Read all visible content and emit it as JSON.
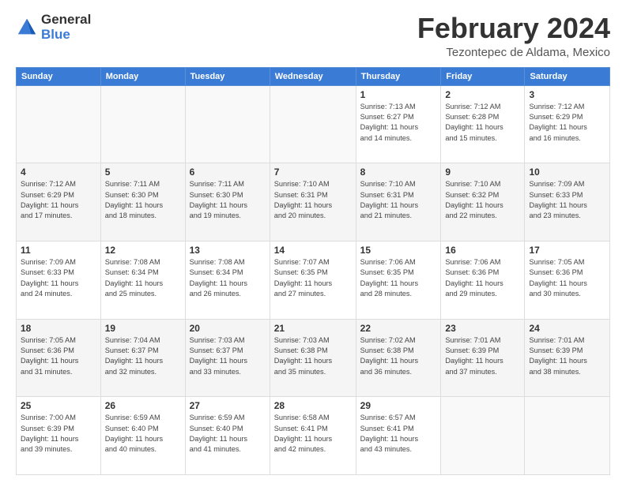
{
  "logo": {
    "general": "General",
    "blue": "Blue"
  },
  "title": "February 2024",
  "subtitle": "Tezontepec de Aldama, Mexico",
  "headers": [
    "Sunday",
    "Monday",
    "Tuesday",
    "Wednesday",
    "Thursday",
    "Friday",
    "Saturday"
  ],
  "weeks": [
    [
      {
        "day": "",
        "info": ""
      },
      {
        "day": "",
        "info": ""
      },
      {
        "day": "",
        "info": ""
      },
      {
        "day": "",
        "info": ""
      },
      {
        "day": "1",
        "info": "Sunrise: 7:13 AM\nSunset: 6:27 PM\nDaylight: 11 hours\nand 14 minutes."
      },
      {
        "day": "2",
        "info": "Sunrise: 7:12 AM\nSunset: 6:28 PM\nDaylight: 11 hours\nand 15 minutes."
      },
      {
        "day": "3",
        "info": "Sunrise: 7:12 AM\nSunset: 6:29 PM\nDaylight: 11 hours\nand 16 minutes."
      }
    ],
    [
      {
        "day": "4",
        "info": "Sunrise: 7:12 AM\nSunset: 6:29 PM\nDaylight: 11 hours\nand 17 minutes."
      },
      {
        "day": "5",
        "info": "Sunrise: 7:11 AM\nSunset: 6:30 PM\nDaylight: 11 hours\nand 18 minutes."
      },
      {
        "day": "6",
        "info": "Sunrise: 7:11 AM\nSunset: 6:30 PM\nDaylight: 11 hours\nand 19 minutes."
      },
      {
        "day": "7",
        "info": "Sunrise: 7:10 AM\nSunset: 6:31 PM\nDaylight: 11 hours\nand 20 minutes."
      },
      {
        "day": "8",
        "info": "Sunrise: 7:10 AM\nSunset: 6:31 PM\nDaylight: 11 hours\nand 21 minutes."
      },
      {
        "day": "9",
        "info": "Sunrise: 7:10 AM\nSunset: 6:32 PM\nDaylight: 11 hours\nand 22 minutes."
      },
      {
        "day": "10",
        "info": "Sunrise: 7:09 AM\nSunset: 6:33 PM\nDaylight: 11 hours\nand 23 minutes."
      }
    ],
    [
      {
        "day": "11",
        "info": "Sunrise: 7:09 AM\nSunset: 6:33 PM\nDaylight: 11 hours\nand 24 minutes."
      },
      {
        "day": "12",
        "info": "Sunrise: 7:08 AM\nSunset: 6:34 PM\nDaylight: 11 hours\nand 25 minutes."
      },
      {
        "day": "13",
        "info": "Sunrise: 7:08 AM\nSunset: 6:34 PM\nDaylight: 11 hours\nand 26 minutes."
      },
      {
        "day": "14",
        "info": "Sunrise: 7:07 AM\nSunset: 6:35 PM\nDaylight: 11 hours\nand 27 minutes."
      },
      {
        "day": "15",
        "info": "Sunrise: 7:06 AM\nSunset: 6:35 PM\nDaylight: 11 hours\nand 28 minutes."
      },
      {
        "day": "16",
        "info": "Sunrise: 7:06 AM\nSunset: 6:36 PM\nDaylight: 11 hours\nand 29 minutes."
      },
      {
        "day": "17",
        "info": "Sunrise: 7:05 AM\nSunset: 6:36 PM\nDaylight: 11 hours\nand 30 minutes."
      }
    ],
    [
      {
        "day": "18",
        "info": "Sunrise: 7:05 AM\nSunset: 6:36 PM\nDaylight: 11 hours\nand 31 minutes."
      },
      {
        "day": "19",
        "info": "Sunrise: 7:04 AM\nSunset: 6:37 PM\nDaylight: 11 hours\nand 32 minutes."
      },
      {
        "day": "20",
        "info": "Sunrise: 7:03 AM\nSunset: 6:37 PM\nDaylight: 11 hours\nand 33 minutes."
      },
      {
        "day": "21",
        "info": "Sunrise: 7:03 AM\nSunset: 6:38 PM\nDaylight: 11 hours\nand 35 minutes."
      },
      {
        "day": "22",
        "info": "Sunrise: 7:02 AM\nSunset: 6:38 PM\nDaylight: 11 hours\nand 36 minutes."
      },
      {
        "day": "23",
        "info": "Sunrise: 7:01 AM\nSunset: 6:39 PM\nDaylight: 11 hours\nand 37 minutes."
      },
      {
        "day": "24",
        "info": "Sunrise: 7:01 AM\nSunset: 6:39 PM\nDaylight: 11 hours\nand 38 minutes."
      }
    ],
    [
      {
        "day": "25",
        "info": "Sunrise: 7:00 AM\nSunset: 6:39 PM\nDaylight: 11 hours\nand 39 minutes."
      },
      {
        "day": "26",
        "info": "Sunrise: 6:59 AM\nSunset: 6:40 PM\nDaylight: 11 hours\nand 40 minutes."
      },
      {
        "day": "27",
        "info": "Sunrise: 6:59 AM\nSunset: 6:40 PM\nDaylight: 11 hours\nand 41 minutes."
      },
      {
        "day": "28",
        "info": "Sunrise: 6:58 AM\nSunset: 6:41 PM\nDaylight: 11 hours\nand 42 minutes."
      },
      {
        "day": "29",
        "info": "Sunrise: 6:57 AM\nSunset: 6:41 PM\nDaylight: 11 hours\nand 43 minutes."
      },
      {
        "day": "",
        "info": ""
      },
      {
        "day": "",
        "info": ""
      }
    ]
  ]
}
